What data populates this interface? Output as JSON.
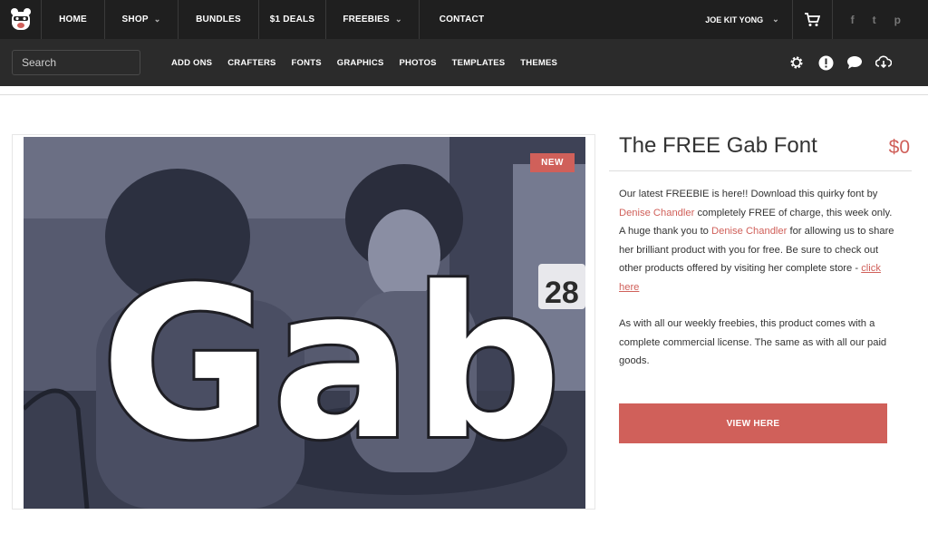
{
  "topnav": {
    "items": [
      {
        "label": "HOME",
        "dropdown": false
      },
      {
        "label": "SHOP",
        "dropdown": true
      },
      {
        "label": "BUNDLES",
        "dropdown": false
      },
      {
        "label": "$1 DEALS",
        "dropdown": false
      },
      {
        "label": "FREEBIES",
        "dropdown": true
      },
      {
        "label": "CONTACT",
        "dropdown": false
      }
    ],
    "user": "JOE KIT YONG",
    "social": [
      "f",
      "t",
      "p"
    ]
  },
  "subnav": {
    "search_placeholder": "Search",
    "categories": [
      "ADD ONS",
      "CRAFTERS",
      "FONTS",
      "GRAPHICS",
      "PHOTOS",
      "TEMPLATES",
      "THEMES"
    ],
    "tools": [
      "gear-icon",
      "alert-icon",
      "chat-icon",
      "cloud-download-icon"
    ]
  },
  "product": {
    "badge": "NEW",
    "image_text": "Gab",
    "image_sign": "28",
    "title": "The FREE Gab Font",
    "price": "$0",
    "desc": {
      "p1_a": "Our latest FREEBIE is here!! Download this quirky font by",
      "link_author_1": "Denise Chandler",
      "p1_b": "completely FREE of charge, this week only. A huge thank you to",
      "link_author_2": "Denise Chandler",
      "p1_c": "for allowing us to share her brilliant product with you for free. Be sure to check out other products offered by visiting her complete store -",
      "link_store": "click here",
      "p2": "As with all our weekly freebies, this product comes with a complete commercial license. The same as with all our paid goods."
    },
    "cta": "VIEW HERE"
  },
  "colors": {
    "accent": "#d0605a",
    "topbar": "#1f1f1f",
    "subbar": "#2b2b2b"
  }
}
